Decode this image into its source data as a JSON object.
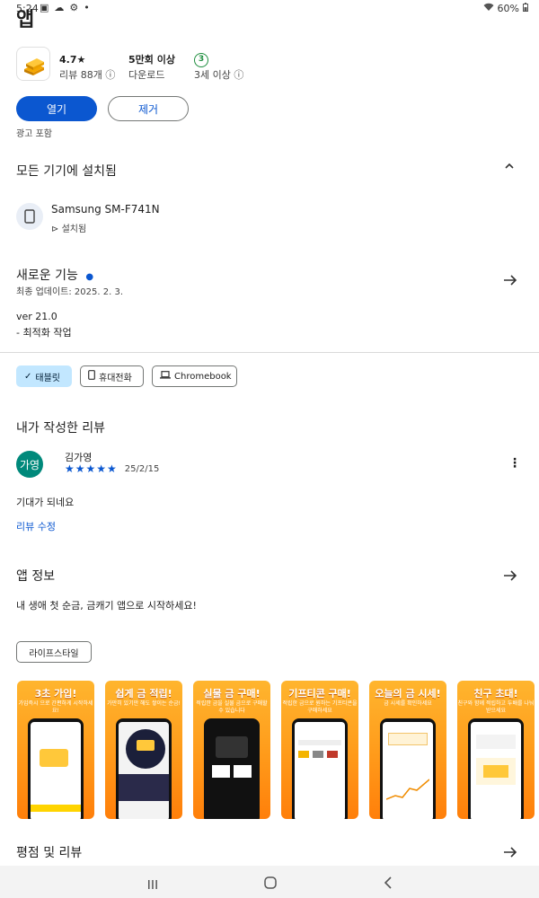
{
  "status_bar": {
    "time": "5:24",
    "battery": "60%"
  },
  "app": {
    "title": "앱"
  },
  "stats": {
    "rating": "4.7★",
    "reviews": "리뷰 88개",
    "downloads": "5만회 이상",
    "downloads_label": "다운로드",
    "age": "3",
    "age_label": "3세 이상"
  },
  "actions": {
    "open": "열기",
    "remove": "제거",
    "ads": "광고 포함"
  },
  "installed": {
    "title": "모든 기기에 설치됨",
    "device": "Samsung SM-F741N",
    "status": "설치됨"
  },
  "whats_new": {
    "title": "새로운 기능",
    "updated": "최종 업데이트: 2025. 2. 3.",
    "version": "ver 21.0",
    "note": "- 최적화 작업"
  },
  "device_chips": [
    "태블릿",
    "휴대전화",
    "Chromebook"
  ],
  "my_review": {
    "title": "내가 작성한 리뷰",
    "avatar": "가영",
    "author": "김가영",
    "stars": "★★★★★",
    "date": "25/2/15",
    "text": "기대가 되네요",
    "edit": "리뷰 수정"
  },
  "about": {
    "title": "앱 정보",
    "desc": "내 생애 첫 순금, 금캐기 앱으로 시작하세요!",
    "tag": "라이프스타일"
  },
  "screenshots": [
    {
      "caption": "3초 가입!",
      "sub": "가입즉시 으로 간편하게 시작하세요!"
    },
    {
      "caption": "쉽게 금 적립!",
      "sub": "가만히 있기만 해도 쌓이는 순금!"
    },
    {
      "caption": "실물 금 구매!",
      "sub": "적립한 금을 실물 금으로 구매할 수 있습니다"
    },
    {
      "caption": "기프티콘 구매!",
      "sub": "적립한 금으로 원하는 기프티콘을 구매하세요"
    },
    {
      "caption": "오늘의 금 시세!",
      "sub": "금 시세를 확인하세요"
    },
    {
      "caption": "친구 초대!",
      "sub": "친구와 함께 적립하고 두배를 나눠받으세요"
    }
  ],
  "ratings": {
    "title": "평점 및 리뷰"
  }
}
